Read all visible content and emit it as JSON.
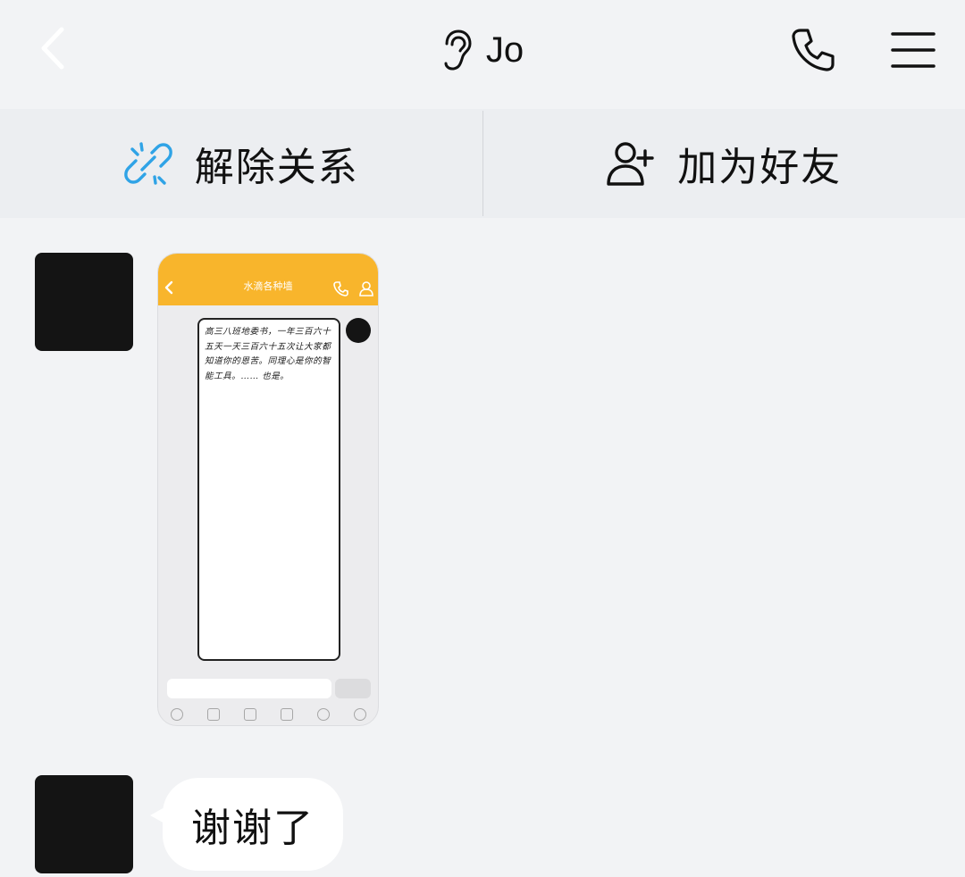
{
  "header": {
    "title": "Jo",
    "back_icon": "chevron-left-icon",
    "ear_icon": "ear-icon",
    "call_icon": "phone-icon",
    "menu_icon": "menu-icon"
  },
  "actions": [
    {
      "label": "解除关系",
      "icon": "broken-link-icon",
      "icon_color": "#2fa3e6"
    },
    {
      "label": "加为好友",
      "icon": "add-user-icon",
      "icon_color": "#111111"
    }
  ],
  "messages": [
    {
      "type": "image",
      "screenshot": {
        "title": "水滴各种墙",
        "accent": "#f8b52c",
        "note_text": "高三八班地委书，一年三百六十五天一天三百六十五次让大家都知道你的恩苦。同理心是你的智能工具。…… 也是。"
      }
    },
    {
      "type": "text",
      "text": "谢谢了"
    }
  ]
}
